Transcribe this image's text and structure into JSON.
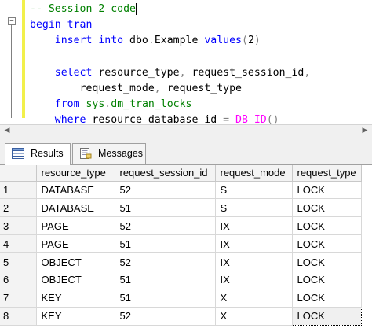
{
  "editor": {
    "lines": [
      [
        {
          "t": "-- Session 2 code",
          "c": "cm"
        }
      ],
      [
        {
          "t": "begin ",
          "c": "kw"
        },
        {
          "t": "tran",
          "c": "kw"
        }
      ],
      [
        {
          "t": "    insert into ",
          "c": "kw"
        },
        {
          "t": "dbo",
          "c": "tx"
        },
        {
          "t": ".",
          "c": "gr"
        },
        {
          "t": "Example ",
          "c": "tx"
        },
        {
          "t": "values",
          "c": "kw"
        },
        {
          "t": "(",
          "c": "gr"
        },
        {
          "t": "2",
          "c": "tx"
        },
        {
          "t": ")",
          "c": "gr"
        }
      ],
      [
        {
          "t": "",
          "c": "tx"
        }
      ],
      [
        {
          "t": "    select ",
          "c": "kw"
        },
        {
          "t": "resource_type",
          "c": "tx"
        },
        {
          "t": ", ",
          "c": "gr"
        },
        {
          "t": "request_session_id",
          "c": "tx"
        },
        {
          "t": ",",
          "c": "gr"
        }
      ],
      [
        {
          "t": "        request_mode",
          "c": "tx"
        },
        {
          "t": ", ",
          "c": "gr"
        },
        {
          "t": "request_type",
          "c": "tx"
        }
      ],
      [
        {
          "t": "    from ",
          "c": "kw"
        },
        {
          "t": "sys",
          "c": "sy"
        },
        {
          "t": ".",
          "c": "gr"
        },
        {
          "t": "dm_tran_locks",
          "c": "sy"
        }
      ],
      [
        {
          "t": "    where ",
          "c": "kw"
        },
        {
          "t": "resource_database_id ",
          "c": "tx"
        },
        {
          "t": "= ",
          "c": "gr"
        },
        {
          "t": "DB_ID",
          "c": "fn"
        },
        {
          "t": "()",
          "c": "gr"
        }
      ]
    ]
  },
  "tabs": {
    "results": "Results",
    "messages": "Messages"
  },
  "grid": {
    "columns": [
      "resource_type",
      "request_session_id",
      "request_mode",
      "request_type"
    ],
    "rows": [
      [
        "1",
        "DATABASE",
        "52",
        "S",
        "LOCK"
      ],
      [
        "2",
        "DATABASE",
        "51",
        "S",
        "LOCK"
      ],
      [
        "3",
        "PAGE",
        "52",
        "IX",
        "LOCK"
      ],
      [
        "4",
        "PAGE",
        "51",
        "IX",
        "LOCK"
      ],
      [
        "5",
        "OBJECT",
        "52",
        "IX",
        "LOCK"
      ],
      [
        "6",
        "OBJECT",
        "51",
        "IX",
        "LOCK"
      ],
      [
        "7",
        "KEY",
        "51",
        "X",
        "LOCK"
      ],
      [
        "8",
        "KEY",
        "52",
        "X",
        "LOCK"
      ]
    ]
  },
  "icons": {
    "collapse": "minus-collapse-icon",
    "results_tab": "grid-icon",
    "messages_tab": "messages-icon",
    "scroll_left": "scroll-left-arrow-icon",
    "scroll_right": "scroll-right-arrow-icon"
  },
  "colors": {
    "keyword": "#0000ff",
    "comment": "#008000",
    "function": "#ff00ff",
    "changebar": "#f2f04a"
  }
}
